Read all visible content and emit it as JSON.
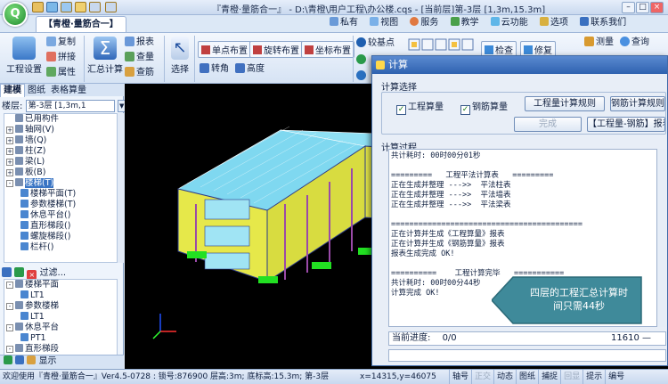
{
  "app": {
    "title": "『青橙·量筋合一』 - D:\\青橙\\用户工程\\办公楼.cqs - [当前层]第-3层 [1,3m,15.3m]"
  },
  "titlebar_menu": [
    {
      "label": "私有",
      "icon": "user-icon"
    },
    {
      "label": "视图",
      "icon": "view-icon"
    },
    {
      "label": "服务",
      "icon": "service-icon"
    },
    {
      "label": "教学",
      "icon": "teach-icon"
    },
    {
      "label": "云功能",
      "icon": "cloud-icon"
    },
    {
      "label": "选项",
      "icon": "options-icon"
    },
    {
      "label": "联系我们",
      "icon": "contact-icon"
    }
  ],
  "ribbon": {
    "tab": "【青橙·量筋合一】",
    "project_settings": "工程设置",
    "copy": "复制",
    "combine": "拼接",
    "props": "属性",
    "calc_summary": "汇总计算",
    "report": "报表",
    "query": "查量",
    "view_rebar": "查筋",
    "select": "选择",
    "single_point": "单点布置",
    "rotate_place": "旋转布置",
    "coord_place": "坐标布置",
    "turn_corner": "转角",
    "height": "高度",
    "check_base": "较基点",
    "check": "检查",
    "modify": "修复",
    "measure": "测量",
    "lookup": "查询"
  },
  "left_panel": {
    "tabs": [
      "建模",
      "图纸",
      "表格算量"
    ],
    "floor_label": "楼层:",
    "floor_value": "第-3层 [1,3m,1",
    "tree": [
      {
        "label": "已用构件",
        "expand": ""
      },
      {
        "label": "轴网(V)",
        "expand": "+"
      },
      {
        "label": "墙(Q)",
        "expand": "+"
      },
      {
        "label": "柱(Z)",
        "expand": "+"
      },
      {
        "label": "梁(L)",
        "expand": "+"
      },
      {
        "label": "板(B)",
        "expand": "+"
      },
      {
        "label": "楼梯(T)",
        "expand": "-",
        "selected": true
      },
      {
        "label": "楼梯平面(T)",
        "expand": "",
        "child": true
      },
      {
        "label": "参数楼梯(T)",
        "expand": "",
        "child": true
      },
      {
        "label": "休息平台()",
        "expand": "",
        "child": true
      },
      {
        "label": "直形梯段()",
        "expand": "",
        "child": true
      },
      {
        "label": "螺旋梯段()",
        "expand": "",
        "child": true
      },
      {
        "label": "栏杆()",
        "expand": "",
        "child": true
      }
    ],
    "filter_label": "过滤...",
    "tree2": [
      {
        "label": "楼梯平面",
        "expand": "-"
      },
      {
        "label": "LT1",
        "expand": "",
        "child": true
      },
      {
        "label": "参数楼梯",
        "expand": "-"
      },
      {
        "label": "LT1",
        "expand": "",
        "child": true
      },
      {
        "label": "休息平台",
        "expand": "-"
      },
      {
        "label": "PT1",
        "expand": "",
        "child": true
      },
      {
        "label": "直形梯段",
        "expand": "-"
      }
    ],
    "bottom_label": "显示"
  },
  "dialog": {
    "title": "计算",
    "calc_select_label": "计算选择",
    "chk_quantity": "工程算量",
    "chk_rebar": "钢筋算量",
    "btn_quantity_rules": "工程量计算规则",
    "btn_rebar_rules": "钢筋计算规则",
    "btn_done": "完成",
    "btn_report": "【工程量-钢筋】报表",
    "process_label": "计算过程",
    "log": "共计耗时: 00时00分01秒\n\n=========   工程平法计算表   =========\n正在生成并整理 --->>  平法柱表\n正在生成并整理 --->>  平法墙表\n正在生成并整理 --->>  平法梁表\n\n==========================================\n正在计算并生成《工程算量》报表\n正在计算并生成《钢筋算量》报表\n报表生成完成 OK!\n\n==========    工程计算完毕   ===========\n共计耗时: 00时00分44秒\n计算完成 OK!",
    "progress_label": "当前进度:",
    "progress_value": "0/0",
    "progress_count": "11610 —"
  },
  "callout": {
    "text1": "四层的工程汇总计算时",
    "text2": "间只需44秒"
  },
  "statusbar": {
    "welcome": "欢迎使用『青橙·量筋合一』Ver4.5-0728 : 锁号:876900 层高:3m; 底标高:15.3m; 第-3层",
    "coords": "x=14315,y=46075",
    "toggles": [
      {
        "label": "轴号",
        "on": true
      },
      {
        "label": "正交",
        "on": false
      },
      {
        "label": "动态",
        "on": true
      },
      {
        "label": "图纸",
        "on": true
      },
      {
        "label": "捕捉",
        "on": true
      },
      {
        "label": "回显",
        "on": false
      },
      {
        "label": "提示",
        "on": true
      },
      {
        "label": "编号",
        "on": true
      }
    ]
  },
  "colors": {
    "accent": "#2f62b0",
    "callout": "#3f8a9a",
    "wall": "#e6e84a",
    "glass": "#9adff0"
  }
}
